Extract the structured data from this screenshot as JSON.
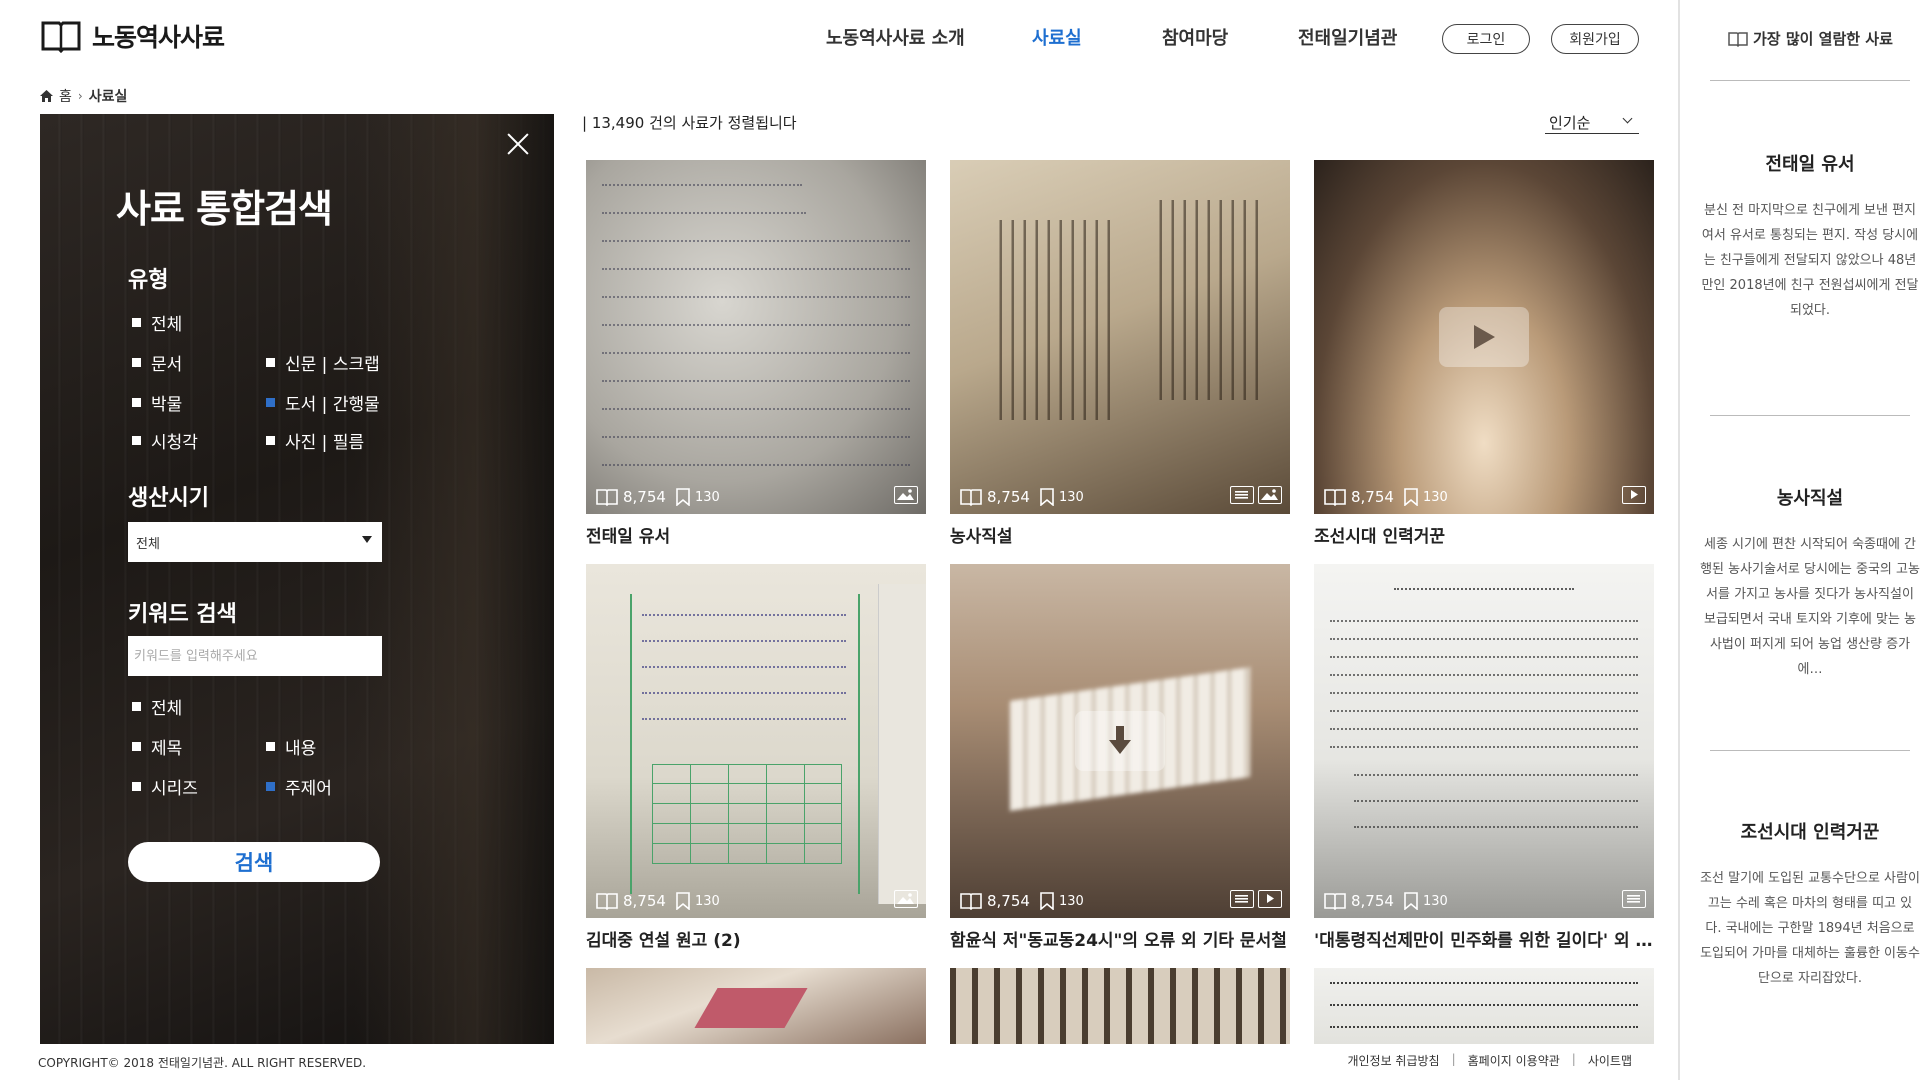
{
  "header": {
    "logo_text": "노동역사사료",
    "nav": [
      {
        "label": "노동역사사료 소개",
        "active": false
      },
      {
        "label": "사료실",
        "active": true
      },
      {
        "label": "참여마당",
        "active": false
      },
      {
        "label": "전태일기념관",
        "active": false
      }
    ],
    "login_label": "로그인",
    "signup_label": "회원가입",
    "accent": "#1e6fd0"
  },
  "breadcrumb": {
    "home": "홈",
    "current": "사료실"
  },
  "search_panel": {
    "title": "사료 통합검색",
    "type_title": "유형",
    "type_options": [
      "전체",
      "문서",
      "신문 | 스크랩",
      "박물",
      "도서 | 간행물",
      "시청각",
      "사진 | 필름"
    ],
    "period_title": "생산시기",
    "period_value": "전체",
    "keyword_title": "키워드 검색",
    "keyword_placeholder": "키워드를 입력해주세요",
    "keyword_scope": [
      "전체",
      "제목",
      "내용",
      "시리즈",
      "주제어"
    ],
    "search_button": "검색"
  },
  "results": {
    "count_text": "| 13,490 건의 사료가 정렬됩니다",
    "sort_label": "인기순",
    "items": [
      {
        "title": "전태일 유서",
        "views": "8,754",
        "bookmarks": "130",
        "types": [
          "image-icon"
        ]
      },
      {
        "title": "농사직설",
        "views": "8,754",
        "bookmarks": "130",
        "types": [
          "document-icon",
          "image-icon"
        ]
      },
      {
        "title": "조선시대 인력거꾼",
        "views": "8,754",
        "bookmarks": "130",
        "types": [
          "video-icon"
        ],
        "overlay": "play-icon"
      },
      {
        "title": "김대중 연설 원고 (2)",
        "views": "8,754",
        "bookmarks": "130",
        "types": [
          "image-icon"
        ]
      },
      {
        "title": "함윤식 저\"동교동24시\"의 오류 외 기타 문서철",
        "views": "8,754",
        "bookmarks": "130",
        "types": [
          "document-icon",
          "video-icon"
        ],
        "overlay": "download-icon"
      },
      {
        "title": "'대통령직선제만이 민주화를 위한 길이다' 외 여러 문서",
        "views": "8,754",
        "bookmarks": "130",
        "types": [
          "document-icon"
        ]
      }
    ]
  },
  "side": {
    "heading": "가장 많이 열람한 사료",
    "items": [
      {
        "title": "전태일 유서",
        "desc": "분신 전 마지막으로 친구에게 보낸 편지여서 유서로 통칭되는 편지. 작성 당시에는 친구들에게 전달되지 않았으나 48년만인 2018년에 친구 전원섭씨에게 전달되었다."
      },
      {
        "title": "농사직설",
        "desc": "세종 시기에 편찬 시작되어 숙종때에 간행된 농사기술서로 당시에는 중국의 고농서를 가지고 농사를 짓다가 농사직설이 보급되면서 국내 토지와 기후에 맞는 농사법이 퍼지게 되어 농업 생산량 증가에…"
      },
      {
        "title": "조선시대 인력거꾼",
        "desc": "조선 말기에 도입된 교통수단으로 사람이 끄는 수레 혹은 마차의 형태를 띠고 있다. 국내에는 구한말 1894년 처음으로 도입되어 가마를 대체하는 훌륭한 이동수단으로 자리잡았다."
      }
    ]
  },
  "footer": {
    "copyright": "COPYRIGHT© 2018 전태일기념관.  ALL RIGHT RESERVED.",
    "links": [
      "개인정보 취급방침",
      "홈페이지 이용약관",
      "사이트맵"
    ]
  }
}
